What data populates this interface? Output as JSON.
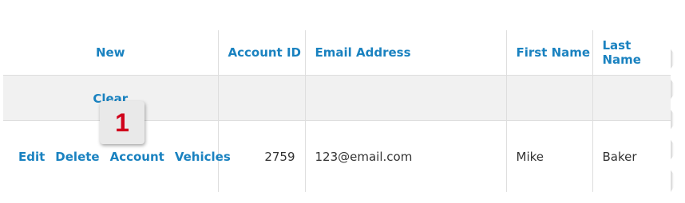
{
  "grid": {
    "columns": [
      {
        "key": "actions",
        "label": "New"
      },
      {
        "key": "account_id",
        "label": "Account ID"
      },
      {
        "key": "email",
        "label": "Email Address"
      },
      {
        "key": "first_name",
        "label": "First Name"
      },
      {
        "key": "last_name",
        "label": "Last Name"
      }
    ],
    "filter_row": {
      "clear_label": "Clear"
    },
    "rows": [
      {
        "actions": [
          "Edit",
          "Delete",
          "Account",
          "Vehicles"
        ],
        "account_id": "2759",
        "email": "123@email.com",
        "first_name": "Mike",
        "last_name": "Baker"
      }
    ]
  },
  "callout": {
    "label": "1"
  },
  "colors": {
    "link": "#1a82c0",
    "callout_number": "#d0021b",
    "filter_row_bg": "#f1f1f1"
  }
}
